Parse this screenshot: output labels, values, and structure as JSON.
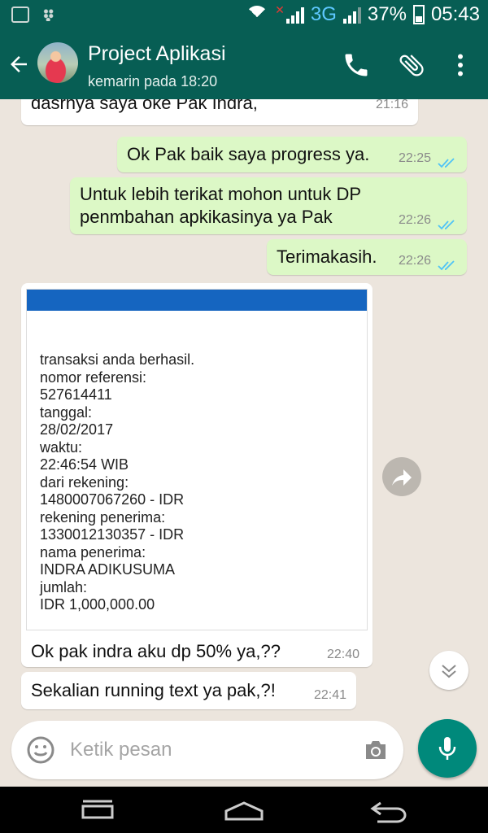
{
  "status_bar": {
    "network": "3G",
    "battery": "37%",
    "time": "05:43",
    "icons": [
      "gallery-icon",
      "bbm-icon",
      "wifi-icon",
      "signal-icon",
      "battery-icon"
    ]
  },
  "header": {
    "title": "Project Aplikasi",
    "subtitle": "kemarin pada 18:20",
    "actions": [
      "phone-icon",
      "attach-icon",
      "more-vert-icon"
    ]
  },
  "messages": [
    {
      "dir": "in",
      "text": "dasrnya saya oke Pak Indra,",
      "time": "21:16"
    },
    {
      "dir": "out",
      "text": "Ok Pak baik saya progress ya.",
      "time": "22:25",
      "read": true
    },
    {
      "dir": "out",
      "line1": "Untuk lebih terikat mohon untuk DP",
      "line2": "penmbahan apkikasinya ya Pak",
      "time": "22:26",
      "read": true
    },
    {
      "dir": "out",
      "text": "Terimakasih.",
      "time": "22:26",
      "read": true
    },
    {
      "dir": "in",
      "image_text": "transaksi anda berhasil.\nnomor referensi:\n527614411\ntanggal:\n28/02/2017\nwaktu:\n22:46:54 WIB\ndari rekening:\n1480007067260 - IDR\nrekening penerima:\n1330012130357 - IDR\nnama penerima:\nINDRA ADIKUSUMA\njumlah:\nIDR 1,000,000.00",
      "caption": "Ok pak indra aku dp 50% ya,??",
      "time": "22:40"
    },
    {
      "dir": "in",
      "text": "Sekalian running text ya pak,?!",
      "time": "22:41"
    }
  ],
  "composer": {
    "placeholder": "Ketik pesan"
  },
  "colors": {
    "header": "#075e54",
    "outgoing_bubble": "#dcf8c6",
    "incoming_bubble": "#ffffff",
    "chat_background": "#ece5dd",
    "fab": "#00897b",
    "read_ticks": "#4fc3f7"
  }
}
